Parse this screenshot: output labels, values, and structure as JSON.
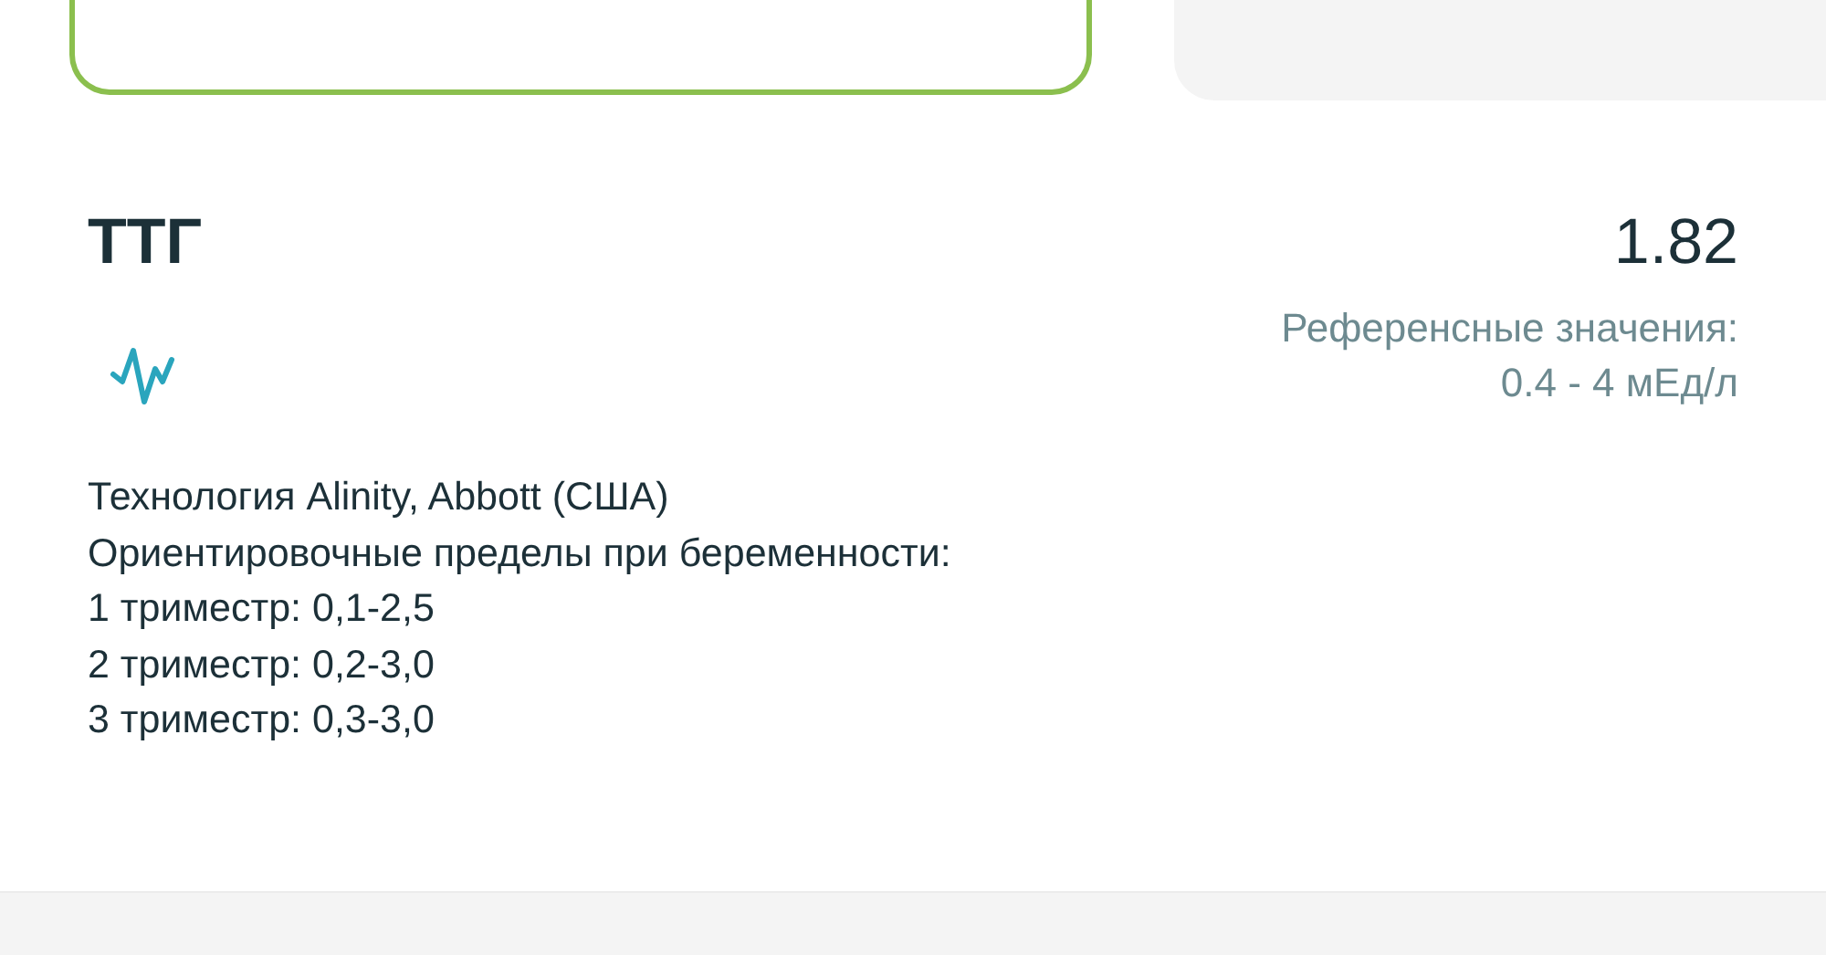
{
  "cards": [
    {
      "selected": true
    },
    {
      "selected": false
    }
  ],
  "test": {
    "name": "ТТГ",
    "value": "1.82",
    "reference_label": "Референсные значения:",
    "reference_range": "0.4 - 4 мЕд/л"
  },
  "notes": [
    "Технология Alinity, Abbott (США)",
    "Ориентировочные пределы при беременности:",
    "1 триместр: 0,1-2,5",
    "2 триместр: 0,2-3,0",
    "3 триместр: 0,3-3,0"
  ]
}
